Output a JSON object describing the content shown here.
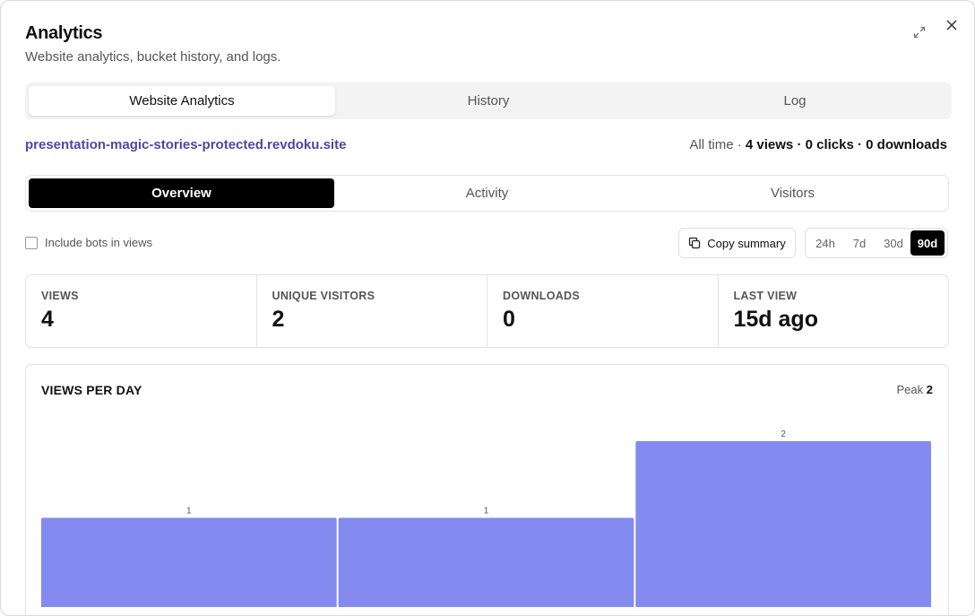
{
  "dialog": {
    "title": "Analytics",
    "subtitle": "Website analytics, bucket history, and logs.",
    "icons": {
      "expand": "expand-icon",
      "close": "close-icon"
    }
  },
  "top_tabs": [
    {
      "label": "Website Analytics",
      "active": true
    },
    {
      "label": "History",
      "active": false
    },
    {
      "label": "Log",
      "active": false
    }
  ],
  "site": {
    "url": "presentation-magic-stories-protected.revdoku.site",
    "period": "All time",
    "summary": "4 views · 0 clicks · 0 downloads"
  },
  "sub_tabs": [
    {
      "label": "Overview",
      "active": true
    },
    {
      "label": "Activity",
      "active": false
    },
    {
      "label": "Visitors",
      "active": false
    }
  ],
  "controls": {
    "include_bots_label": "Include bots in views",
    "include_bots_checked": false,
    "copy_label": "Copy summary",
    "ranges": [
      "24h",
      "7d",
      "30d",
      "90d"
    ],
    "active_range": "90d"
  },
  "kpis": [
    {
      "label": "VIEWS",
      "value": "4"
    },
    {
      "label": "UNIQUE VISITORS",
      "value": "2"
    },
    {
      "label": "DOWNLOADS",
      "value": "0"
    },
    {
      "label": "LAST VIEW",
      "value": "15d ago"
    }
  ],
  "colors": {
    "bar": "#838af0",
    "link": "#4f46a5"
  },
  "chart_data": {
    "type": "bar",
    "title": "VIEWS PER DAY",
    "peak_label": "Peak",
    "peak_value": "2",
    "categories": [
      "",
      "",
      ""
    ],
    "values": [
      1,
      1,
      2
    ],
    "ylim": [
      0,
      2
    ]
  }
}
